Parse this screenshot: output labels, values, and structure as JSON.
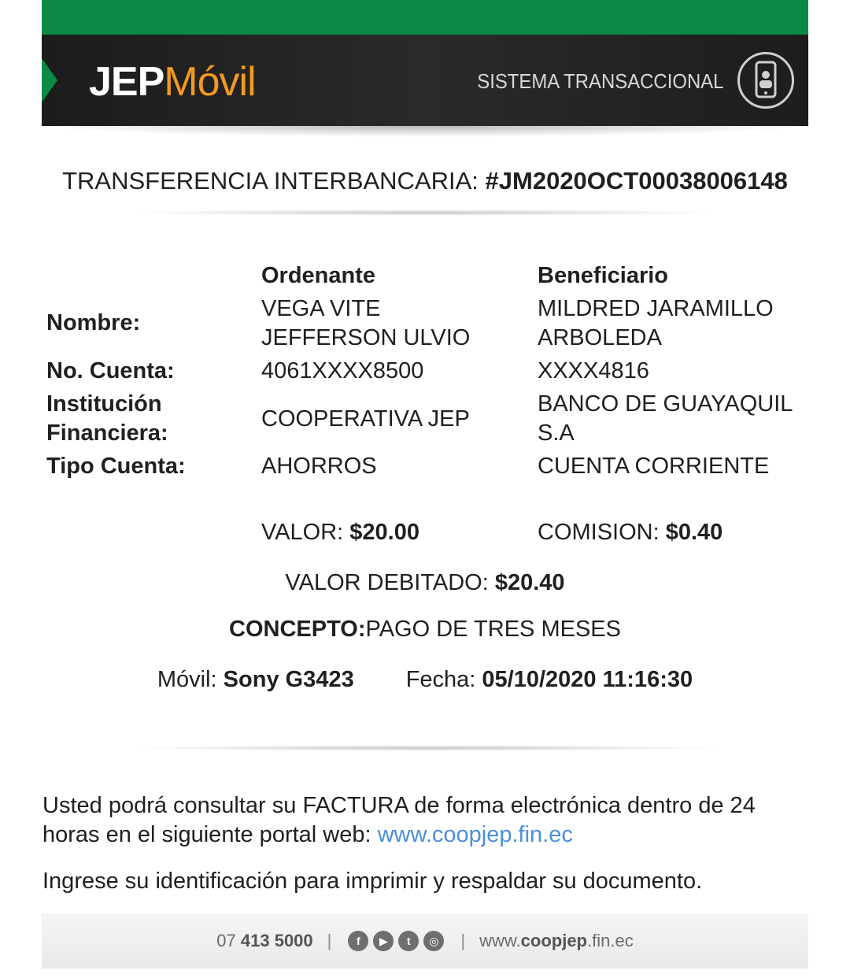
{
  "header": {
    "logo_bold": "JEP",
    "logo_light": "Móvil",
    "system_label": "SISTEMA TRANSACCIONAL"
  },
  "transfer": {
    "title_prefix": "TRANSFERENCIA INTERBANCARIA: ",
    "reference": "#JM2020OCT00038006148"
  },
  "table": {
    "col_ordenante": "Ordenante",
    "col_beneficiario": "Beneficiario",
    "rows": [
      {
        "label": "Nombre:",
        "ordenante": "VEGA VITE JEFFERSON ULVIO",
        "beneficiario": "MILDRED JARAMILLO ARBOLEDA"
      },
      {
        "label": "No. Cuenta:",
        "ordenante": "4061XXXX8500",
        "beneficiario": "XXXX4816"
      },
      {
        "label": "Institución Financiera:",
        "ordenante": "COOPERATIVA JEP",
        "beneficiario": "BANCO DE GUAYAQUIL S.A"
      },
      {
        "label": "Tipo Cuenta:",
        "ordenante": "AHORROS",
        "beneficiario": "CUENTA CORRIENTE"
      }
    ]
  },
  "amounts": {
    "valor_label": "VALOR: ",
    "valor": "$20.00",
    "comision_label": "COMISION: ",
    "comision": "$0.40",
    "debitado_label": "VALOR DEBITADO: ",
    "debitado": "$20.40",
    "concepto_label": "CONCEPTO:",
    "concepto": "PAGO DE TRES MESES"
  },
  "device": {
    "movil_label": "Móvil: ",
    "movil": "Sony G3423",
    "fecha_label": "Fecha: ",
    "fecha": "05/10/2020 11:16:30"
  },
  "notice": {
    "line1_text": "Usted podrá consultar su FACTURA de forma electrónica dentro de 24 horas en el siguiente portal web: ",
    "link": "www.coopjep.fin.ec",
    "line2": "Ingrese su identificación para imprimir y respaldar su documento."
  },
  "footer": {
    "phone_prefix": "07 ",
    "phone_main": "413 5000",
    "social_icons": [
      "facebook-icon",
      "youtube-icon",
      "twitter-icon",
      "instagram-icon"
    ],
    "web_prefix": "www.",
    "web_bold": "coopjep",
    "web_suffix": ".fin.ec"
  },
  "colors": {
    "brand_green": "#0a8a44",
    "brand_orange": "#f39a1f",
    "banner_dark": "#1c1c1c",
    "link_blue": "#4a8fd9"
  }
}
